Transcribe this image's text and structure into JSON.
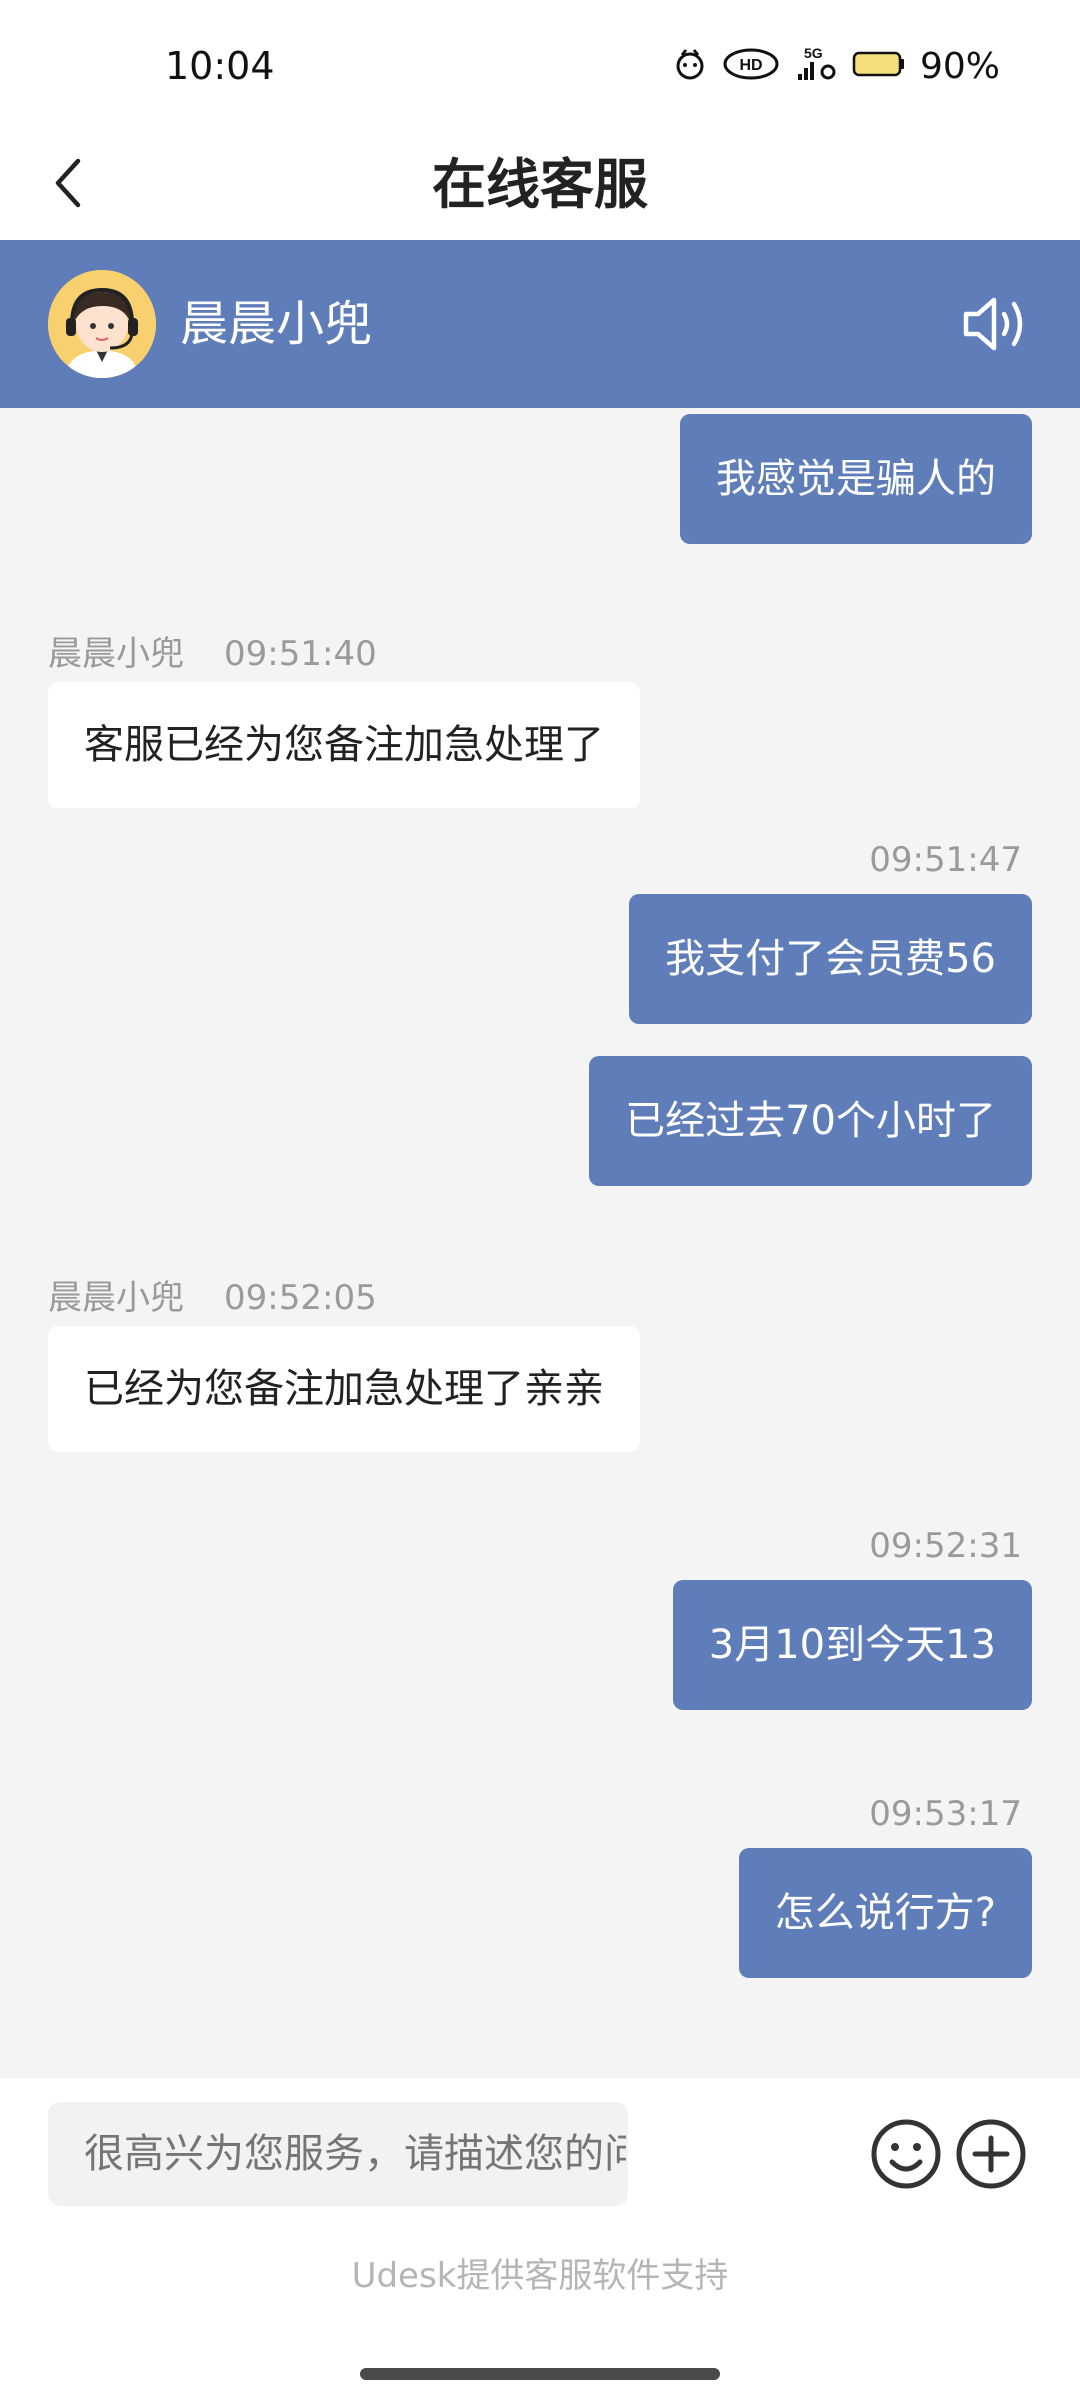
{
  "status_bar": {
    "time": "10:04",
    "icons": [
      "notification-icon",
      "hd-voice-icon",
      "5g-signal-icon",
      "battery-icon"
    ],
    "battery": "90%"
  },
  "header": {
    "title": "在线客服",
    "back_icon": "chevron-left-icon"
  },
  "agent": {
    "name": "晨晨小兜",
    "avatar_icon": "customer-service-avatar-icon",
    "sound_icon": "speaker-icon"
  },
  "messages": [
    {
      "side": "out",
      "text": "我感觉是骗人的"
    },
    {
      "side": "in",
      "sender": "晨晨小兜",
      "time": "09:51:40",
      "text": "客服已经为您备注加急处理了"
    },
    {
      "side": "out",
      "time": "09:51:47",
      "text": "我支付了会员费56"
    },
    {
      "side": "out",
      "text": "已经过去70个小时了"
    },
    {
      "side": "in",
      "sender": "晨晨小兜",
      "time": "09:52:05",
      "text": "已经为您备注加急处理了亲亲"
    },
    {
      "side": "out",
      "time": "09:52:31",
      "text": "3月10到今天13"
    },
    {
      "side": "out",
      "time": "09:53:17",
      "text": "怎么说行方?"
    }
  ],
  "composer": {
    "placeholder": "很高兴为您服务，请描述您的问题",
    "emoji_icon": "emoji-icon",
    "plus_icon": "plus-circle-icon",
    "powered_by": "Udesk提供客服软件支持"
  },
  "colors": {
    "accent": "#5f7db9",
    "background": "#f4f4f4",
    "bubble_in": "#ffffff",
    "meta_text": "#9a9a9a"
  }
}
